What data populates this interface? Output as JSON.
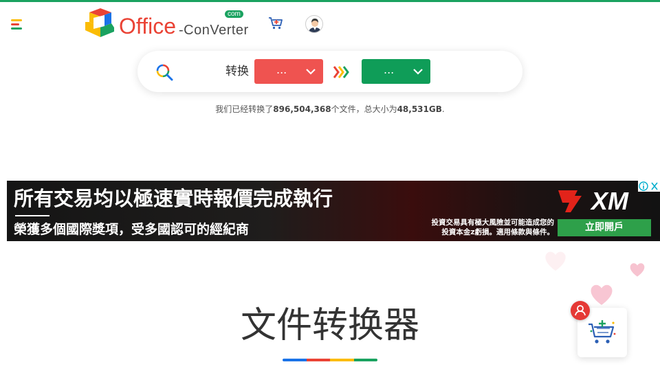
{
  "colors": {
    "blue": "#1a73e8",
    "red": "#ea4335",
    "yellow": "#fbbc05",
    "green": "#1aa260",
    "select_red": "#ef5350",
    "select_green": "#0f9d58"
  },
  "header": {
    "menu_icon": "hamburger-menu-icon",
    "logo": {
      "word": "Office",
      "suffix": "-ConVerter",
      "badge": "com"
    },
    "cart_icon": "cart-icon",
    "avatar_icon": "user-avatar-icon"
  },
  "converter": {
    "search_icon": "search-icon",
    "label": "转换",
    "from_value": "...",
    "to_value": "...",
    "arrows_icon": "double-chevron-right-icon"
  },
  "stats": {
    "prefix": "我们已经转换了",
    "files_count": "896,504,368",
    "middle": "个文件，总大小为",
    "total_size": "48,531GB",
    "suffix": "."
  },
  "ad": {
    "headline": "所有交易均以極速實時報價完成執行",
    "subline": "榮獲多個國際獎項，受多國認可的經紀商",
    "brand": "XM",
    "disclaimer_1": "投資交易具有極大風險並可能造成您的",
    "disclaimer_2": "投資本金z虧損。適用條款與條件。",
    "cta": "立即開戶"
  },
  "main": {
    "title": "文件转换器"
  },
  "widget": {
    "cart_icon": "shopping-cart-add-icon",
    "badge_icon": "user-badge-icon"
  }
}
